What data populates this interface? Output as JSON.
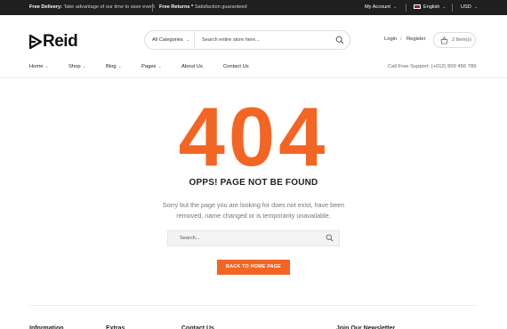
{
  "topbar": {
    "promo1_title": "Free Delivery:",
    "promo1_text": "Take advantage of our time to save event",
    "promo2_title": "Free Returns *",
    "promo2_text": "Satisfaction guaranteed",
    "account_label": "My Account",
    "language_label": "English",
    "currency_label": "USD"
  },
  "header": {
    "logo_text": "Reid",
    "search_category": "All Categories",
    "search_placeholder": "Search entire store here...",
    "login_label": "Login",
    "register_label": "Register",
    "cart_label": "2 Item(s)"
  },
  "nav": {
    "items": [
      {
        "label": "Home",
        "has_dropdown": true
      },
      {
        "label": "Shop",
        "has_dropdown": true
      },
      {
        "label": "Blog",
        "has_dropdown": true
      },
      {
        "label": "Pages",
        "has_dropdown": true
      },
      {
        "label": "About Us",
        "has_dropdown": false
      },
      {
        "label": "Contact Us",
        "has_dropdown": false
      }
    ],
    "support_text": "Call Free Support: (+012) 800 456 789"
  },
  "error": {
    "code": "404",
    "heading": "OPPS! PAGE NOT BE FOUND",
    "description": "Sorry but the page you are looking for does not exist, have been removed, name changed or is temporarity unavailable.",
    "search_placeholder": "Search...",
    "button_label": "BACK TO HOME PAGE"
  },
  "footer": {
    "columns": [
      "Information",
      "Extras",
      "Contact Us",
      "Join Our Newsletter"
    ]
  },
  "colors": {
    "accent": "#f36523",
    "topbar_bg": "#1f1f1f"
  }
}
